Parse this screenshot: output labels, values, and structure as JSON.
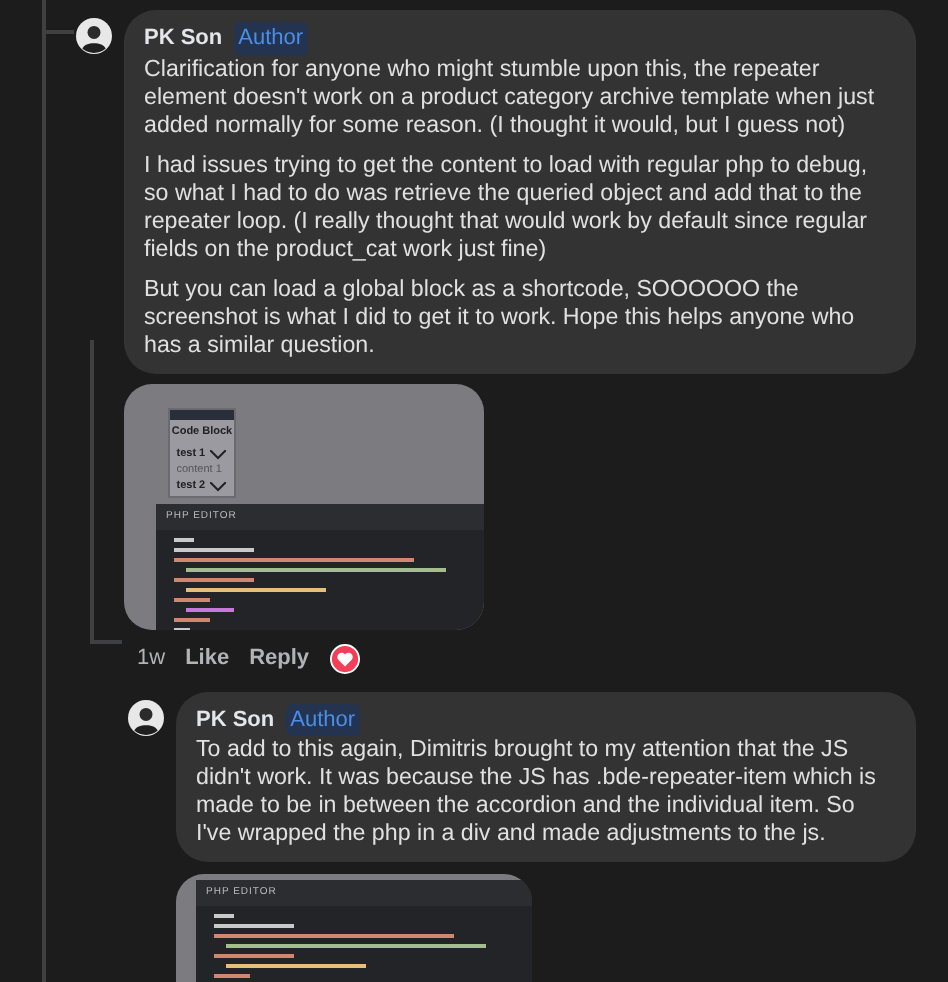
{
  "comments": [
    {
      "author": "PK Son",
      "badge": "Author",
      "paragraphs": [
        "Clarification for anyone who might stumble upon this, the repeater element doesn't work on a product category archive template when just added normally for some reason. (I thought it would, but I guess not)",
        "I had issues trying to get the content to load with regular php to debug, so what I had to do was retrieve the queried object and add that to the repeater loop. (I really thought that would work by default since regular fields on the product_cat work just fine)",
        "But you can load a global block as a shortcode, SOOOOOO the screenshot is what I did to get it to work. Hope this helps anyone who has a similar question."
      ],
      "attachment": {
        "accordion": {
          "title": "Code Block",
          "items": [
            {
              "label": "test 1",
              "content": "content 1"
            },
            {
              "label": "test 2"
            }
          ]
        },
        "editor_title": "PHP EDITOR"
      },
      "actions": {
        "time": "1w",
        "like": "Like",
        "reply": "Reply",
        "love_reaction": true
      }
    },
    {
      "author": "PK Son",
      "badge": "Author",
      "paragraphs": [
        "To add to this again, Dimitris brought to my attention that the JS didn't work. It was because the JS has .bde-repeater-item which is made to be in between the accordion and the individual item. So I've wrapped the php in a div and made adjustments to the js."
      ],
      "attachment": {
        "editor_title": "PHP EDITOR"
      }
    }
  ]
}
